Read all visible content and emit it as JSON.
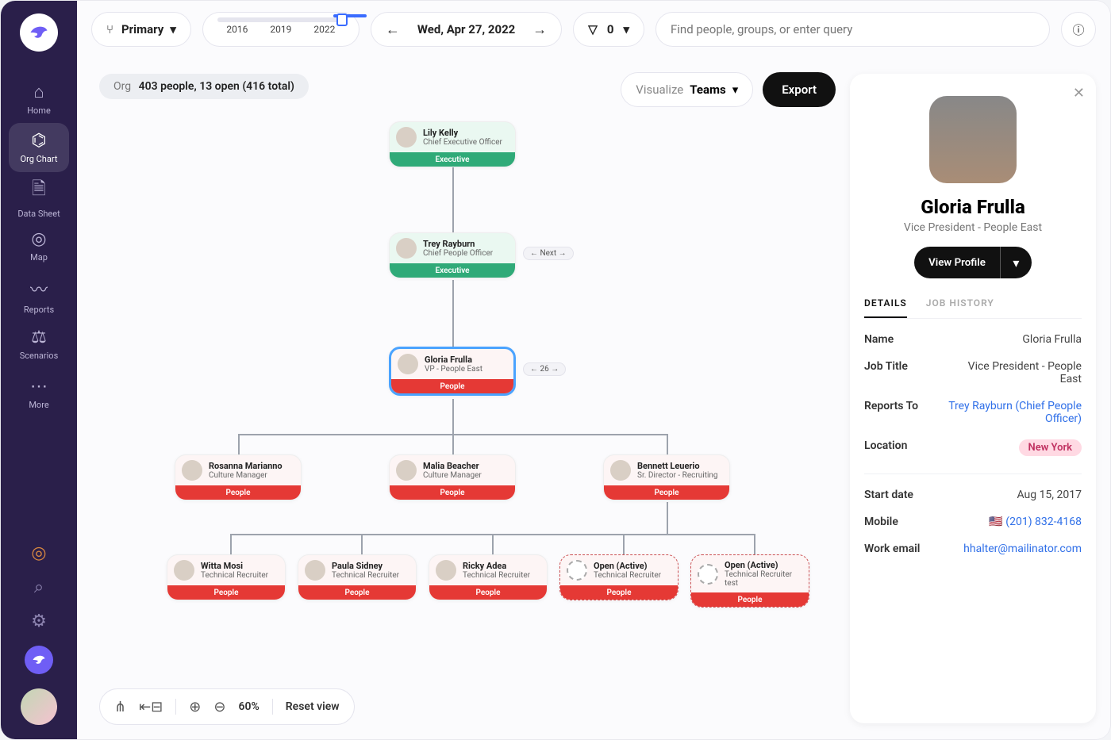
{
  "sidebar": {
    "nav": [
      {
        "icon": "⌂",
        "label": "Home"
      },
      {
        "icon": "⌬",
        "label": "Org Chart"
      },
      {
        "icon": "🗎",
        "label": "Data Sheet"
      },
      {
        "icon": "◎",
        "label": "Map"
      },
      {
        "icon": "〰",
        "label": "Reports"
      },
      {
        "icon": "⚖",
        "label": "Scenarios"
      },
      {
        "icon": "⋯",
        "label": "More"
      }
    ]
  },
  "topbar": {
    "selector_label": "Primary",
    "timeline_years": [
      "2016",
      "2019",
      "2022"
    ],
    "date": "Wed, Apr 27, 2022",
    "filter_count": "0",
    "search_placeholder": "Find people, groups, or enter query"
  },
  "crumb": {
    "prefix": "Org",
    "text": "403 people, 13 open (416 total)"
  },
  "controls": {
    "visualize_label": "Visualize",
    "visualize_value": "Teams",
    "export": "Export"
  },
  "tree": {
    "n0": {
      "name": "Lily Kelly",
      "title": "Chief Executive Officer",
      "band": "Executive"
    },
    "n1": {
      "name": "Trey Rayburn",
      "title": "Chief People Officer",
      "band": "Executive"
    },
    "n2": {
      "name": "Gloria Frulla",
      "title": "VP - People East",
      "band": "People"
    },
    "side1": "← Next →",
    "side2": "← 26 →",
    "n3": {
      "name": "Rosanna Marianno",
      "title": "Culture Manager",
      "band": "People"
    },
    "n4": {
      "name": "Malia Beacher",
      "title": "Culture Manager",
      "band": "People"
    },
    "n5": {
      "name": "Bennett Leuerio",
      "title": "Sr. Director - Recruiting",
      "band": "People"
    },
    "n6": {
      "name": "Witta Mosi",
      "title": "Technical Recruiter",
      "band": "People"
    },
    "n7": {
      "name": "Paula Sidney",
      "title": "Technical Recruiter",
      "band": "People"
    },
    "n8": {
      "name": "Ricky Adea",
      "title": "Technical Recruiter",
      "band": "People"
    },
    "n9": {
      "name": "Open (Active)",
      "title": "Technical Recruiter",
      "band": "People"
    },
    "n10": {
      "name": "Open (Active)",
      "title": "Technical Recruiter test",
      "band": "People"
    }
  },
  "bottombar": {
    "zoom": "60%",
    "reset": "Reset view"
  },
  "panel": {
    "name": "Gloria Frulla",
    "title": "Vice President - People East",
    "view": "View Profile",
    "tabs": [
      "DETAILS",
      "JOB HISTORY"
    ],
    "details": {
      "name_k": "Name",
      "name_v": "Gloria Frulla",
      "jobtitle_k": "Job Title",
      "jobtitle_v": "Vice President - People East",
      "reports_k": "Reports To",
      "reports_v": "Trey Rayburn (Chief People Officer)",
      "location_k": "Location",
      "location_v": "New York",
      "start_k": "Start date",
      "start_v": "Aug 15, 2017",
      "mobile_k": "Mobile",
      "mobile_flag": "🇺🇸",
      "mobile_v": "(201) 832-4168",
      "email_k": "Work email",
      "email_v": "hhalter@mailinator.com"
    }
  }
}
